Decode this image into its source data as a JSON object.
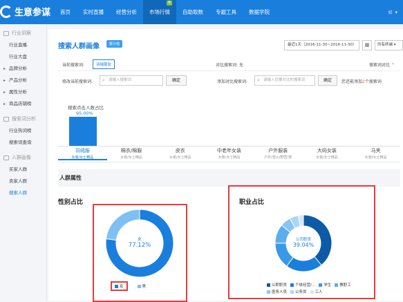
{
  "app": {
    "logo_text": "生意参谋"
  },
  "nav": {
    "items": [
      "首页",
      "实时直播",
      "经营分析",
      "市场行情",
      "自助取数",
      "专题工具",
      "数据学院"
    ],
    "active_index": 3,
    "badge": "专"
  },
  "user": {
    "name": "如"
  },
  "sidebar": {
    "sections": [
      {
        "title": "行业洞察",
        "items": [
          {
            "label": "行业直播",
            "expand": false
          },
          {
            "label": "行业大盘",
            "expand": false
          },
          {
            "label": "品牌分析",
            "expand": true
          },
          {
            "label": "产品分析",
            "expand": true
          },
          {
            "label": "属性分析",
            "expand": true
          },
          {
            "label": "商品店铺榜",
            "expand": true
          }
        ]
      },
      {
        "title": "搜索词分析",
        "items": [
          {
            "label": "行业热词榜",
            "expand": false
          },
          {
            "label": "搜索词查询",
            "expand": false
          }
        ]
      },
      {
        "title": "人群画像",
        "items": [
          {
            "label": "买家人群",
            "expand": false
          },
          {
            "label": "卖家人群",
            "expand": false
          },
          {
            "label": "搜索人群",
            "expand": false,
            "active": true
          }
        ]
      }
    ]
  },
  "header": {
    "title": "搜索人群画像",
    "badge": "累计值",
    "date_range": "最近1天（2016-11-30~2016-11-30）",
    "terminal": "所有终端"
  },
  "filters": {
    "current_label": "当前搜索词:",
    "current_tag": "羽绒服女",
    "compare_label": "对比搜索词: 无",
    "toggle_label": "搜索词对比",
    "modify_label": "修改当前搜索词:",
    "modify_placeholder": "请输入搜索词",
    "confirm_label": "确定",
    "add_label": "添加对比搜索词:",
    "add_placeholder": "请输入您要对比的搜索词",
    "confirm2_label": "确定",
    "hint_pre": "您还能添加",
    "hint_num": "2",
    "hint_post": "个搜索词"
  },
  "bar_chart": {
    "title": "搜索点击人数占比",
    "value_label": "95.00%",
    "value": 95.0
  },
  "categories": [
    {
      "name": "羽绒服",
      "sub": "女装/女士精品",
      "active": true
    },
    {
      "name": "棉衣/棉服",
      "sub": "女装/女士精品"
    },
    {
      "name": "皮衣",
      "sub": "女装/女士精品"
    },
    {
      "name": "中老年女装",
      "sub": "女装/女士精品"
    },
    {
      "name": "户外服装",
      "sub": "户外/登山/野营/旅"
    },
    {
      "name": "大码女装",
      "sub": "女装/女士精品"
    },
    {
      "name": "马夹",
      "sub": "女装/女士精品"
    }
  ],
  "section": {
    "title": "人群属性"
  },
  "gender_card": {
    "title": "性别占比"
  },
  "job_card": {
    "title": "职业占比"
  },
  "chart_data": [
    {
      "type": "pie",
      "title": "性别占比",
      "center_label": "女",
      "center_value": "77.12%",
      "labels": [
        "女",
        "男"
      ],
      "values": [
        77.12,
        22.88
      ],
      "colors": [
        "#1a7fdc",
        "#7ec0f4"
      ]
    },
    {
      "type": "pie",
      "title": "职业占比",
      "center_label": "公司职员",
      "center_value": "39.04%",
      "labels": [
        "公司职员",
        "个体经营/服务人员",
        "学生",
        "教职工",
        "医务人员",
        "公务员",
        "工人"
      ],
      "values": [
        39.04,
        21.0,
        15.0,
        11.0,
        6.0,
        5.0,
        2.96
      ],
      "colors": [
        "#0d5aa7",
        "#1a7fdc",
        "#3a98e8",
        "#5aaeef",
        "#85c4f4",
        "#abd6f8",
        "#d0e8fb"
      ],
      "legend": [
        "公职职员",
        "个体经营/…",
        "学生",
        "教职工",
        "医务人员",
        "公务员",
        "工人"
      ]
    }
  ]
}
